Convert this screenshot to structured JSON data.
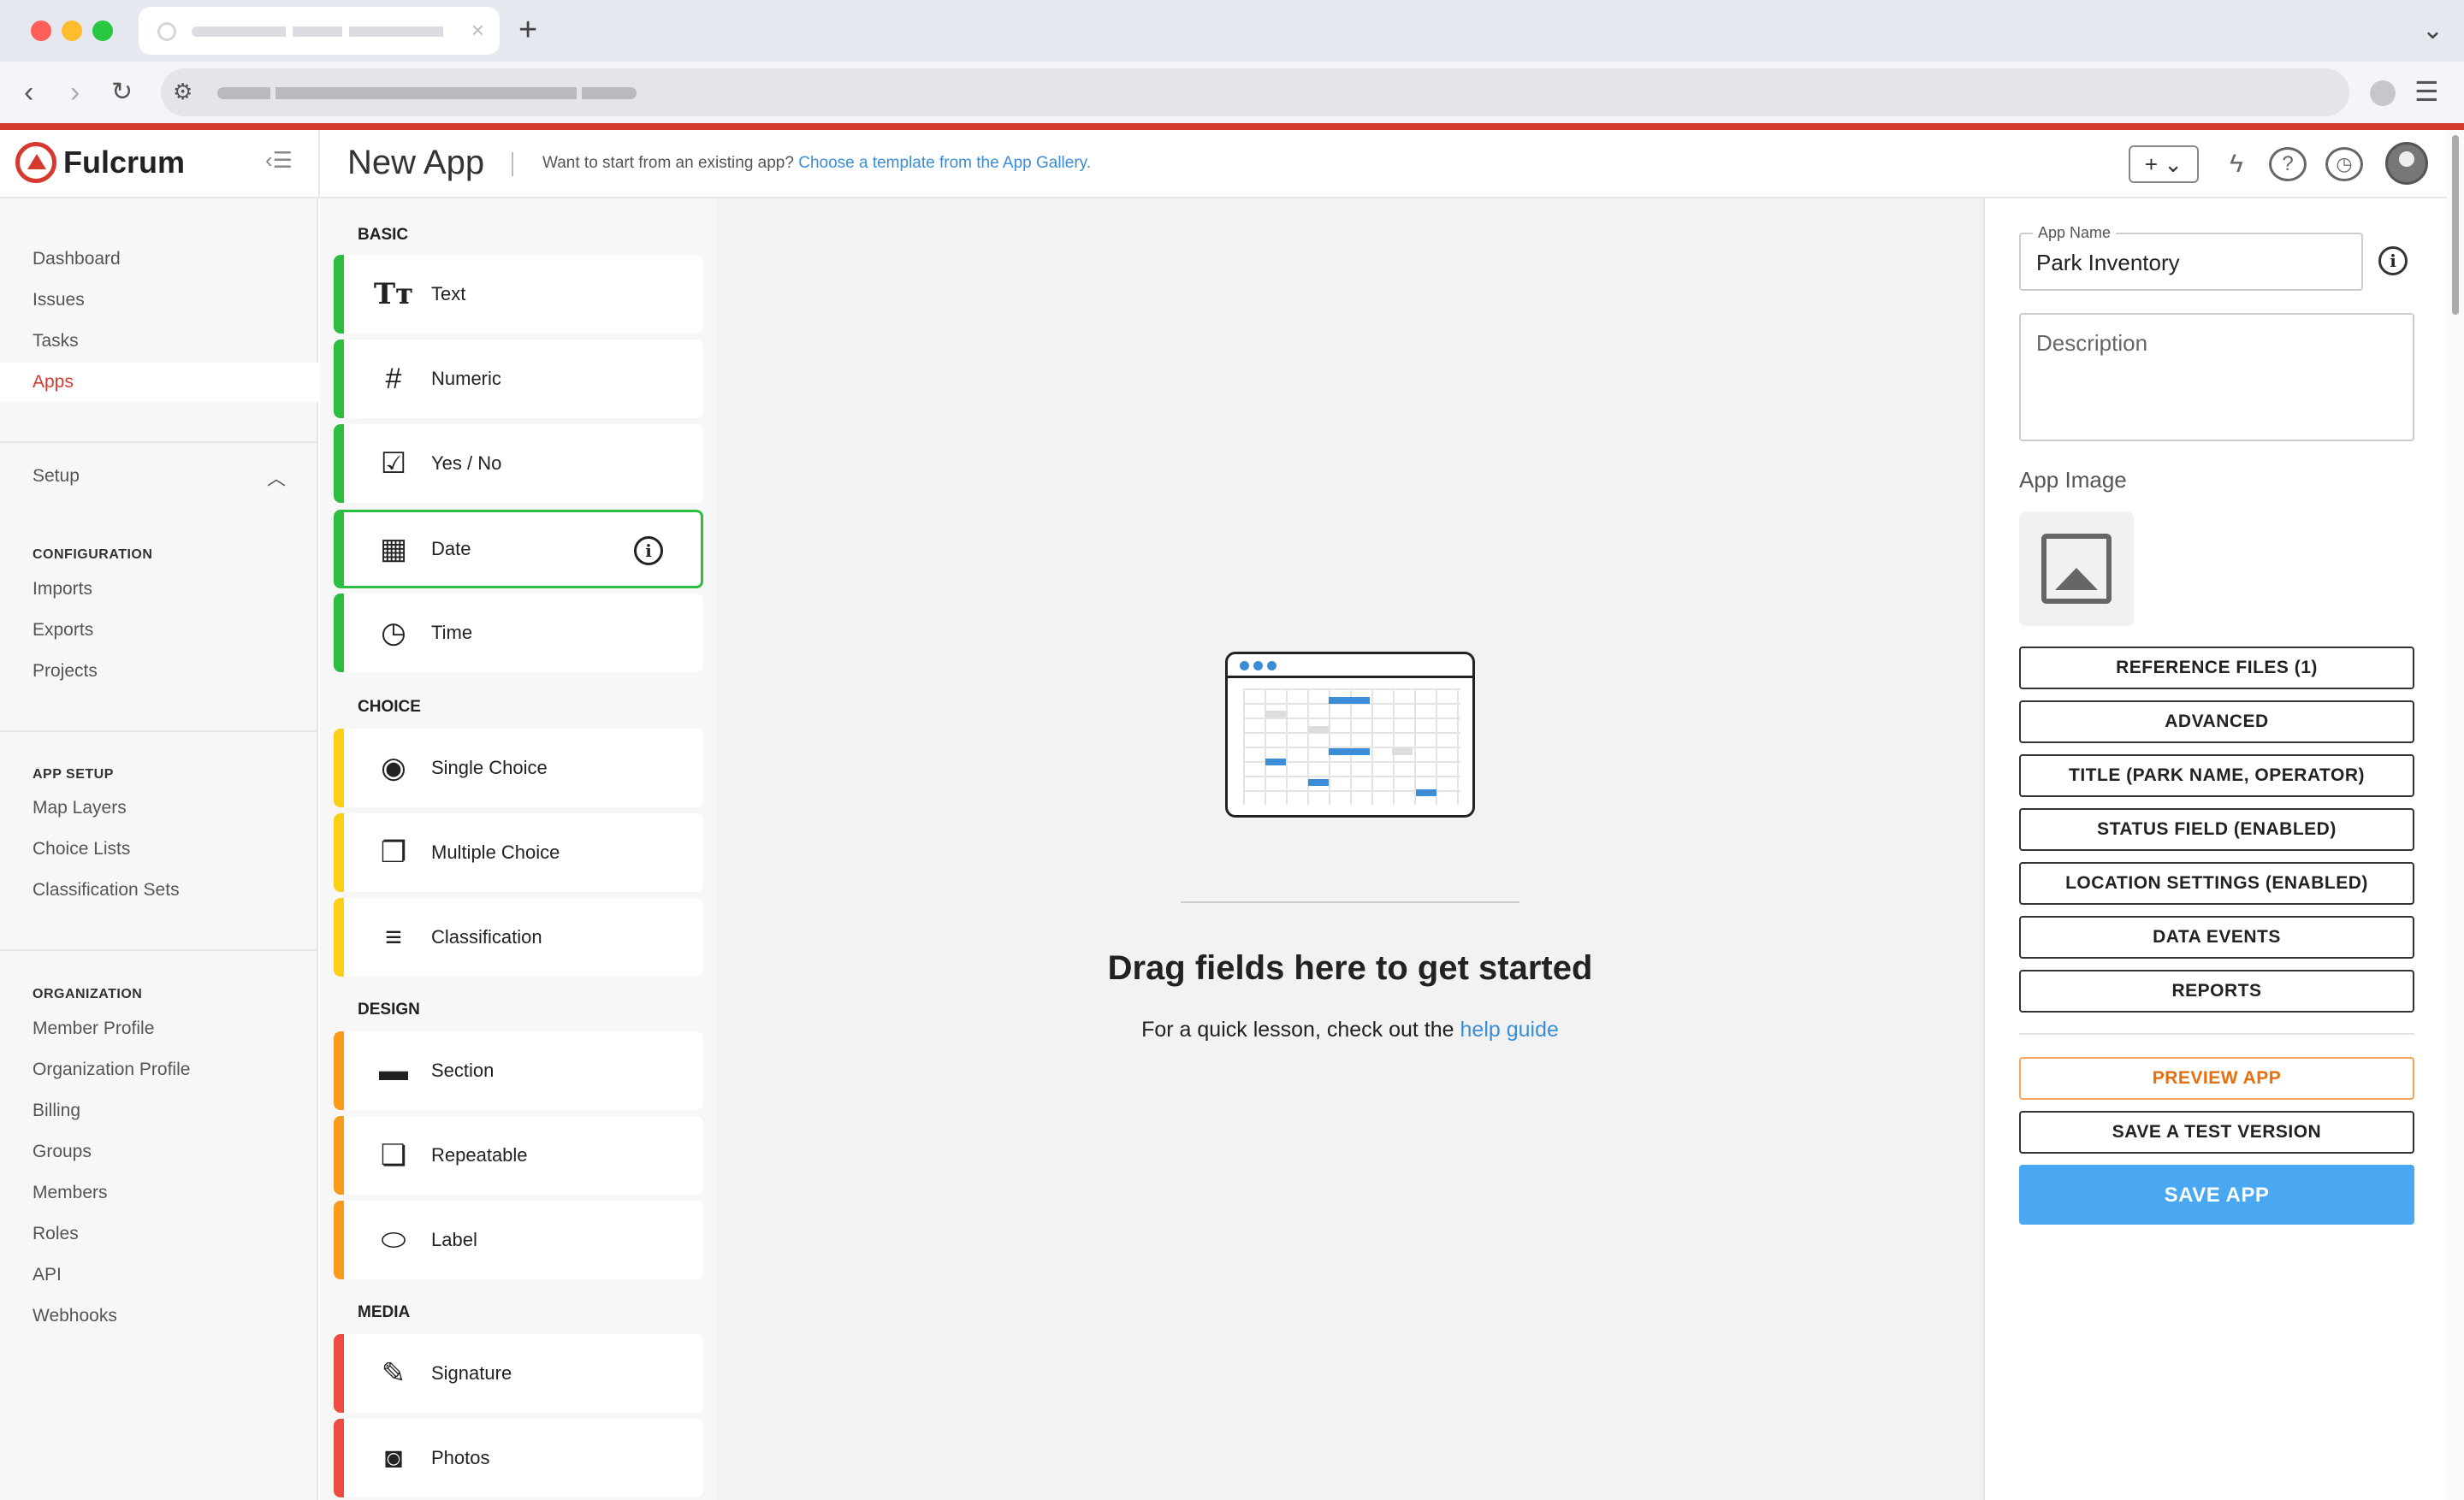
{
  "browser": {
    "tab_close": "×",
    "new_tab": "+",
    "tab_list": "⌄"
  },
  "app": {
    "logo": "Fulcrum",
    "page_title": "New App",
    "hint_prefix": "Want to start from an existing app?",
    "hint_link": "Choose a template from the App Gallery.",
    "add_button": "+ ⌄"
  },
  "sidebar": {
    "main": [
      "Dashboard",
      "Issues",
      "Tasks",
      "Apps"
    ],
    "setup": "Setup",
    "configuration": {
      "title": "CONFIGURATION",
      "items": [
        "Imports",
        "Exports",
        "Projects"
      ]
    },
    "app_setup": {
      "title": "APP SETUP",
      "items": [
        "Map Layers",
        "Choice Lists",
        "Classification Sets"
      ]
    },
    "organization": {
      "title": "ORGANIZATION",
      "items": [
        "Member Profile",
        "Organization Profile",
        "Billing",
        "Groups",
        "Members",
        "Roles",
        "API",
        "Webhooks"
      ]
    }
  },
  "palette": {
    "basic": {
      "title": "BASIC",
      "items": [
        "Text",
        "Numeric",
        "Yes / No",
        "Date",
        "Time"
      ]
    },
    "choice": {
      "title": "CHOICE",
      "items": [
        "Single Choice",
        "Multiple Choice",
        "Classification"
      ]
    },
    "design": {
      "title": "DESIGN",
      "items": [
        "Section",
        "Repeatable",
        "Label"
      ]
    },
    "media": {
      "title": "MEDIA",
      "items": [
        "Signature",
        "Photos"
      ]
    }
  },
  "canvas": {
    "title": "Drag fields here to get started",
    "sub_prefix": "For a quick lesson, check out the",
    "sub_link": "help guide"
  },
  "panel": {
    "app_name_label": "App Name",
    "app_name_value": "Park Inventory",
    "description_placeholder": "Description",
    "app_image_label": "App Image",
    "buttons": [
      "REFERENCE FILES (1)",
      "ADVANCED",
      "TITLE (PARK NAME, OPERATOR)",
      "STATUS FIELD (ENABLED)",
      "LOCATION SETTINGS (ENABLED)",
      "DATA EVENTS",
      "REPORTS"
    ],
    "preview": "PREVIEW APP",
    "save_test": "SAVE A TEST VERSION",
    "save": "SAVE APP"
  },
  "colors": {
    "brand": "#d63a2f",
    "link": "#3a8dd6",
    "basic": "#2dbd3f",
    "choice": "#fbcf16",
    "design": "#f99b1c",
    "media": "#ee4b41",
    "save_button": "#4aa8f2"
  }
}
